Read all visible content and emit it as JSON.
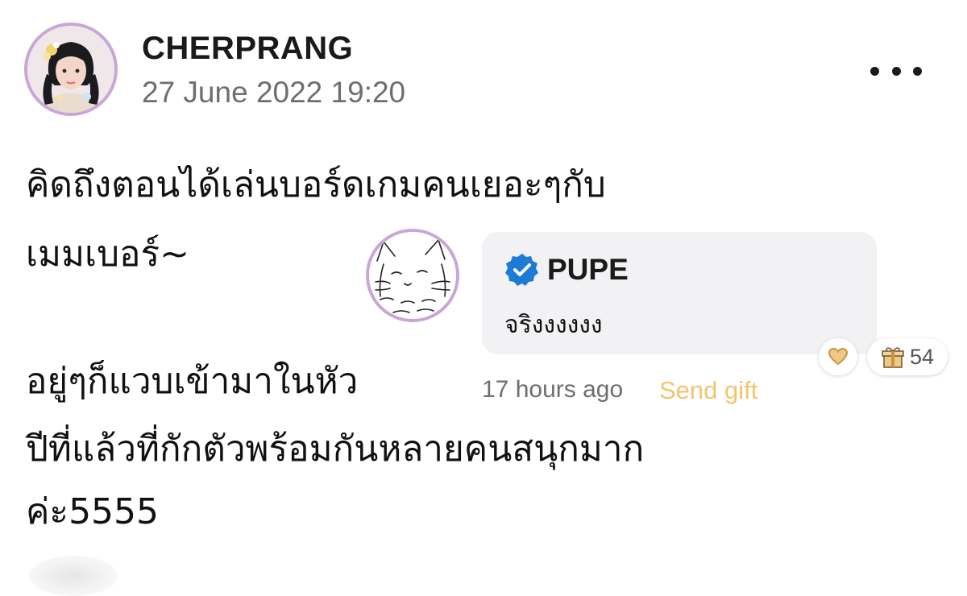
{
  "post": {
    "author": "CHERPRANG",
    "timestamp": "27 June 2022 19:20",
    "lines": [
      "คิดถึงตอนได้เล่นบอร์ดเกมคนเยอะๆกับ",
      "เมมเบอร์~",
      "อยู่ๆก็แวบเข้ามาในหัว",
      "ปีที่แล้วที่กักตัวพร้อมกันหลายคนสนุกมาก",
      "ค่ะ5555"
    ],
    "menu_icon": "more-horizontal-icon"
  },
  "comment": {
    "author": "PUPE",
    "verified_icon": "verified-badge-icon",
    "text": "จริงงงงงง",
    "time": "17 hours ago",
    "send_gift_label": "Send gift",
    "like_icon": "heart-icon",
    "gift_icon": "gift-icon",
    "gift_count": "54"
  },
  "colors": {
    "avatar_ring": "#c9a6d6",
    "bubble_bg": "#f2f2f4",
    "verified_blue": "#1d7bd8",
    "send_gift": "#f2c46e",
    "heart": "#e7b66a",
    "muted_text": "#6e6e6e"
  }
}
